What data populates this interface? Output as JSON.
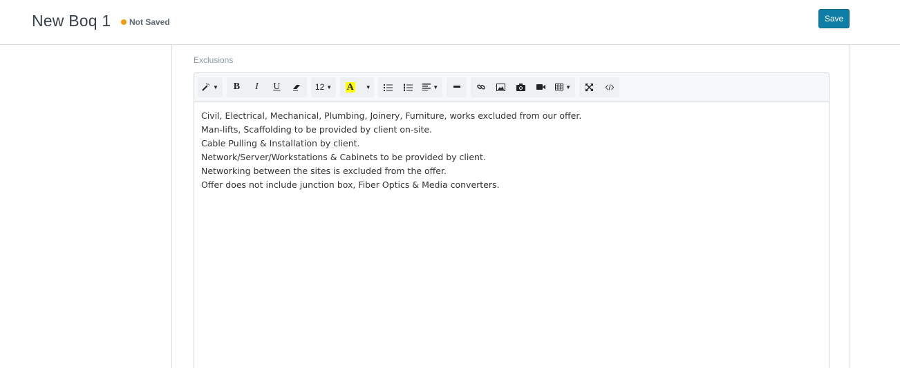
{
  "header": {
    "title": "New Boq 1",
    "status": "Not Saved",
    "save_label": "Save"
  },
  "field": {
    "label": "Exclusions"
  },
  "toolbar": {
    "font_size": "12",
    "highlight_letter": "A"
  },
  "editor": {
    "lines": [
      "Civil, Electrical, Mechanical, Plumbing, Joinery, Furniture, works excluded from our offer.",
      "Man-lifts, Scaffolding to be provided by client on-site.",
      "Cable Pulling & Installation by client.",
      "Network/Server/Workstations & Cabinets to be provided by client.",
      "Networking between the sites is excluded from the offer.",
      "Offer does not include junction box, Fiber Optics & Media converters."
    ]
  },
  "colors": {
    "accent": "#0e7ea6",
    "status_dot": "#f39c12",
    "highlight": "#ffff00"
  }
}
